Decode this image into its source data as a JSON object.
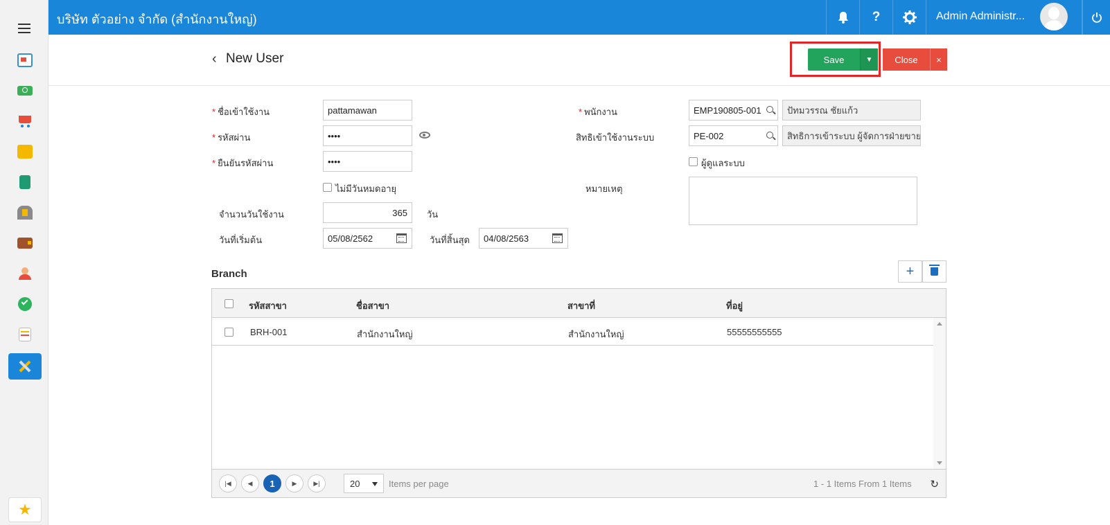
{
  "header": {
    "company": "บริษัท ตัวอย่าง จำกัด (สำนักงานใหญ่)",
    "admin_name": "Admin Administr...",
    "bell_icon": "bell-icon",
    "help_label": "?",
    "settings_icon": "gear-icon",
    "power_icon": "power-icon",
    "brand_color": "#1a86d9"
  },
  "page": {
    "title": "New User",
    "save_label": "Save",
    "close_label": "Close",
    "close_x": "×"
  },
  "form": {
    "username_label": "ชื่อเข้าใช้งาน",
    "username_value": "pattamawan",
    "password_label": "รหัสผ่าน",
    "password_value": "••••",
    "confirm_label": "ยืนยันรหัสผ่าน",
    "confirm_value": "••••",
    "no_expire_label": "ไม่มีวันหมดอายุ",
    "days_label": "จำนวนวันใช้งาน",
    "days_value": "365",
    "days_unit": "วัน",
    "start_label": "วันที่เริ่มต้น",
    "start_value": "05/08/2562",
    "end_label": "วันที่สิ้นสุด",
    "end_value": "04/08/2563",
    "employee_label": "พนักงาน",
    "employee_code": "EMP190805-001",
    "employee_name": "ปัทมวรรณ   ชัยแก้ว",
    "rights_label": "สิทธิเข้าใช้งานระบบ",
    "rights_code": "PE-002",
    "rights_name": "สิทธิการเข้าระบบ ผู้จัดการฝ่ายขายแ",
    "admin_label": "ผู้ดูแลระบบ",
    "remark_label": "หมายเหตุ"
  },
  "branch": {
    "title": "Branch",
    "add_label": "+",
    "columns": [
      "รหัสสาขา",
      "ชื่อสาขา",
      "สาขาที่",
      "ที่อยู่"
    ],
    "rows": [
      [
        "BRH-001",
        "สำนักงานใหญ่",
        "สำนักงานใหญ่",
        "55555555555"
      ]
    ],
    "pager": {
      "current_page": "1",
      "page_size": "20",
      "per_page_label": "Items per page",
      "summary": "1 - 1 Items From 1 Items"
    }
  }
}
